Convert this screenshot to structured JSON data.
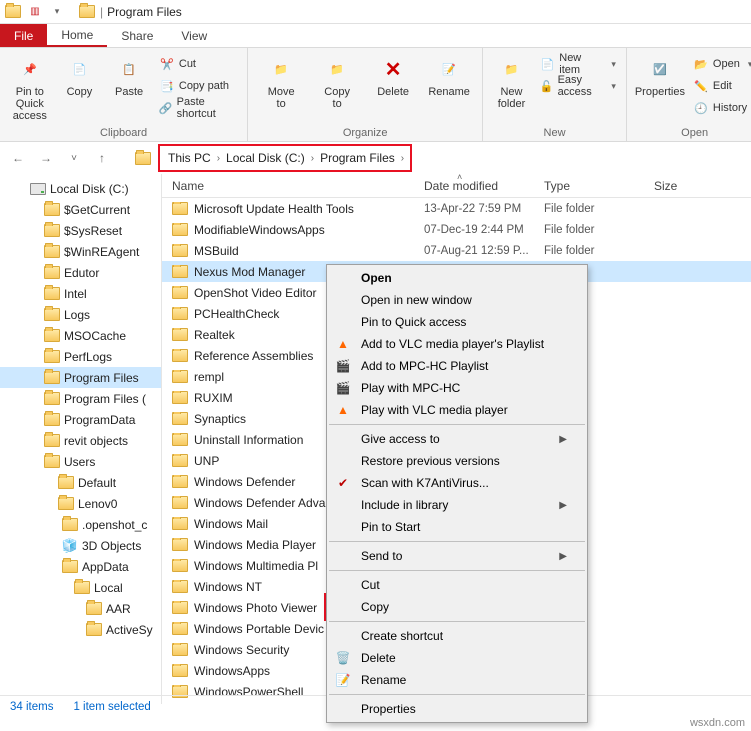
{
  "title": "Program Files",
  "tabs": {
    "file": "File",
    "home": "Home",
    "share": "Share",
    "view": "View"
  },
  "ribbon": {
    "clipboard": {
      "label": "Clipboard",
      "pin": "Pin to Quick\naccess",
      "copy": "Copy",
      "paste": "Paste",
      "cut": "Cut",
      "copypath": "Copy path",
      "pasteshort": "Paste shortcut"
    },
    "organize": {
      "label": "Organize",
      "moveto": "Move\nto",
      "copyto": "Copy\nto",
      "delete": "Delete",
      "rename": "Rename"
    },
    "new": {
      "label": "New",
      "newfolder": "New\nfolder",
      "newitem": "New item",
      "easyaccess": "Easy access"
    },
    "open": {
      "label": "Open",
      "properties": "Properties",
      "open": "Open",
      "edit": "Edit",
      "history": "History"
    }
  },
  "breadcrumb": [
    "This PC",
    "Local Disk (C:)",
    "Program Files"
  ],
  "columns": {
    "name": "Name",
    "date": "Date modified",
    "type": "Type",
    "size": "Size"
  },
  "sidebar": [
    {
      "label": "Local Disk (C:)",
      "kind": "drive",
      "depth": 0
    },
    {
      "label": "$GetCurrent",
      "depth": 1
    },
    {
      "label": "$SysReset",
      "depth": 1
    },
    {
      "label": "$WinREAgent",
      "depth": 1
    },
    {
      "label": "Edutor",
      "depth": 1
    },
    {
      "label": "Intel",
      "depth": 1
    },
    {
      "label": "Logs",
      "depth": 1
    },
    {
      "label": "MSOCache",
      "depth": 1
    },
    {
      "label": "PerfLogs",
      "depth": 1
    },
    {
      "label": "Program Files",
      "depth": 1,
      "selected": true
    },
    {
      "label": "Program Files (",
      "depth": 1
    },
    {
      "label": "ProgramData",
      "depth": 1
    },
    {
      "label": "revit objects",
      "depth": 1
    },
    {
      "label": "Users",
      "depth": 1
    },
    {
      "label": "Default",
      "depth": 2
    },
    {
      "label": "Lenov0",
      "depth": 2
    },
    {
      "label": ".openshot_c",
      "depth": 2,
      "extra": true
    },
    {
      "label": "3D Objects",
      "depth": 2,
      "extra": true,
      "kind": "3d"
    },
    {
      "label": "AppData",
      "depth": 2,
      "extra": true
    },
    {
      "label": "Local",
      "depth": 2,
      "extra": true,
      "sub": true
    },
    {
      "label": "AAR",
      "depth": 2,
      "extra": true,
      "sub2": true
    },
    {
      "label": "ActiveSy",
      "depth": 2,
      "extra": true,
      "sub2": true
    }
  ],
  "files": [
    {
      "name": "Microsoft Update Health Tools",
      "date": "13-Apr-22 7:59 PM",
      "type": "File folder"
    },
    {
      "name": "ModifiableWindowsApps",
      "date": "07-Dec-19 2:44 PM",
      "type": "File folder"
    },
    {
      "name": "MSBuild",
      "date": "07-Aug-21 12:59 P...",
      "type": "File folder"
    },
    {
      "name": "Nexus Mod Manager",
      "selected": true
    },
    {
      "name": "OpenShot Video Editor"
    },
    {
      "name": "PCHealthCheck"
    },
    {
      "name": "Realtek"
    },
    {
      "name": "Reference Assemblies"
    },
    {
      "name": "rempl"
    },
    {
      "name": "RUXIM"
    },
    {
      "name": "Synaptics"
    },
    {
      "name": "Uninstall Information"
    },
    {
      "name": "UNP"
    },
    {
      "name": "Windows Defender"
    },
    {
      "name": "Windows Defender Adva"
    },
    {
      "name": "Windows Mail"
    },
    {
      "name": "Windows Media Player"
    },
    {
      "name": "Windows Multimedia Pl"
    },
    {
      "name": "Windows NT"
    },
    {
      "name": "Windows Photo Viewer"
    },
    {
      "name": "Windows Portable Devic"
    },
    {
      "name": "Windows Security"
    },
    {
      "name": "WindowsApps"
    },
    {
      "name": "WindowsPowerShell"
    }
  ],
  "context": {
    "open": "Open",
    "opennew": "Open in new window",
    "pinquick": "Pin to Quick access",
    "vlcadd": "Add to VLC media player's Playlist",
    "mpcadd": "Add to MPC-HC Playlist",
    "mpcplay": "Play with MPC-HC",
    "vlcplay": "Play with VLC media player",
    "giveaccess": "Give access to",
    "restore": "Restore previous versions",
    "scan": "Scan with K7AntiVirus...",
    "library": "Include in library",
    "pinstart": "Pin to Start",
    "sendto": "Send to",
    "cut": "Cut",
    "copy": "Copy",
    "shortcut": "Create shortcut",
    "delete": "Delete",
    "rename": "Rename",
    "properties": "Properties"
  },
  "status": {
    "items": "34 items",
    "selected": "1 item selected"
  },
  "watermark": "wsxdn.com"
}
